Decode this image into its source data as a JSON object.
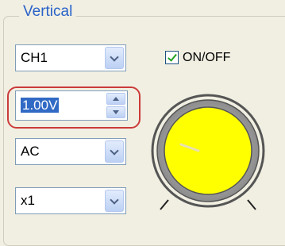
{
  "group": {
    "label": "Vertical"
  },
  "channel_select": {
    "value": "CH1"
  },
  "volts_spin": {
    "value": "1.00V"
  },
  "coupling_select": {
    "value": "AC"
  },
  "probe_select": {
    "value": "x1"
  },
  "onoff": {
    "label": "ON/OFF",
    "checked": true
  },
  "knob": {
    "color": "#ffff00"
  }
}
